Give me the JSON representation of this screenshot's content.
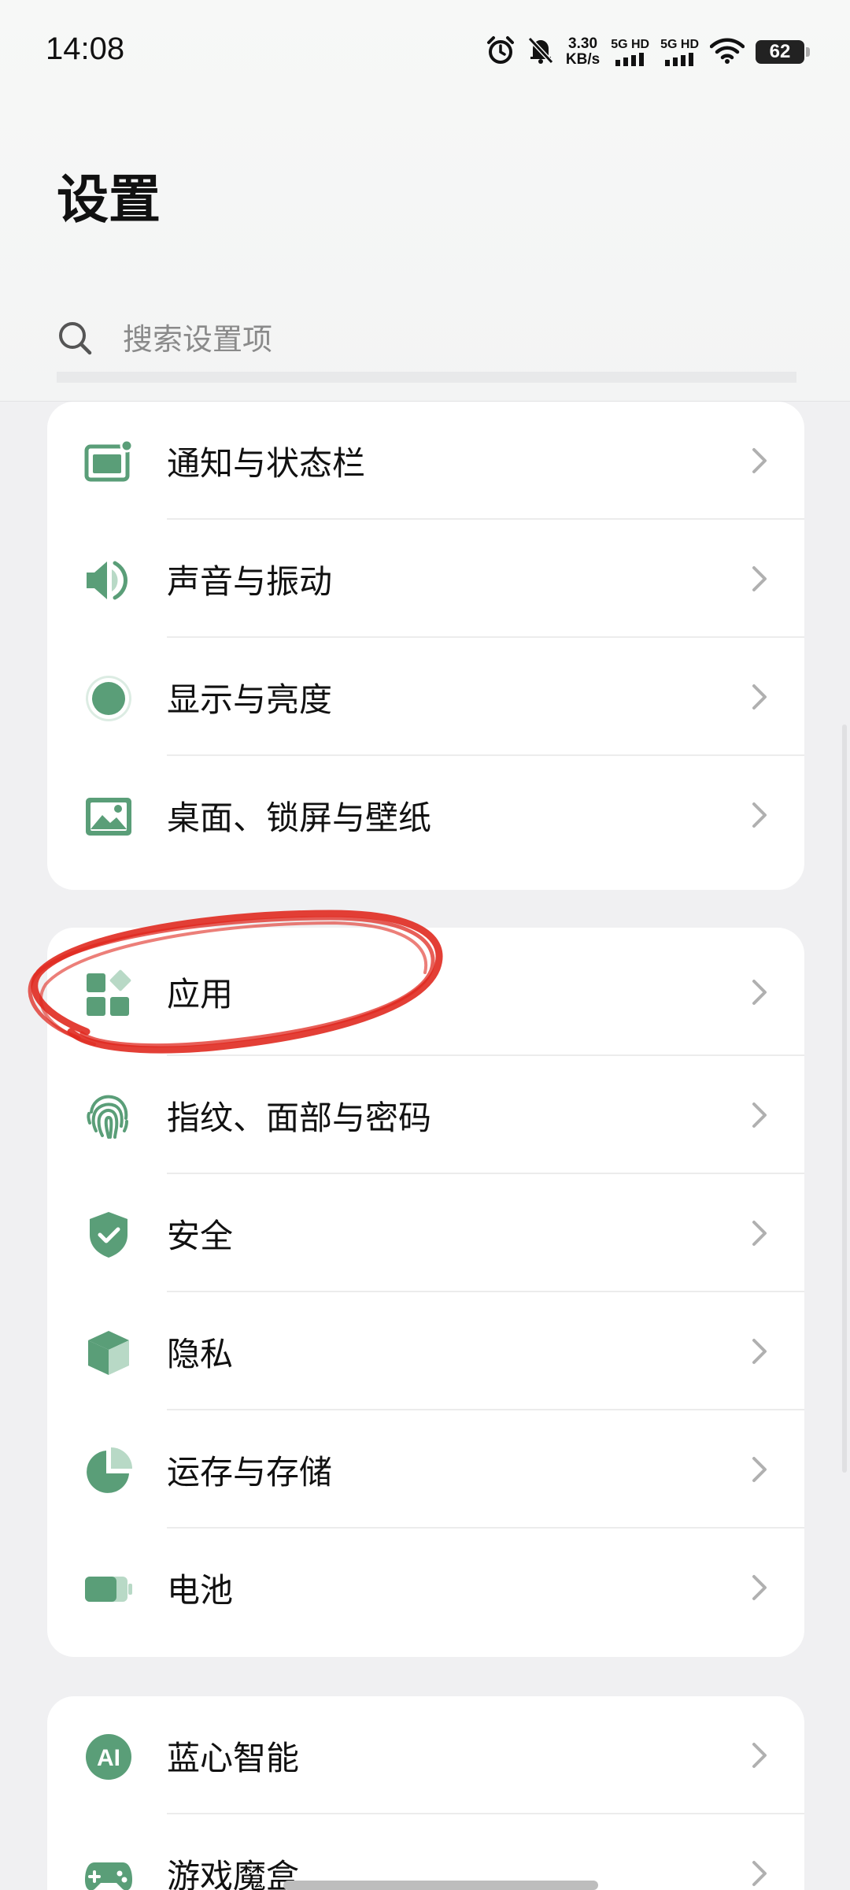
{
  "status_bar": {
    "time": "14:08",
    "net_speed_value": "3.30",
    "net_speed_unit": "KB/s",
    "sim1": "5G HD",
    "sim2": "5G HD",
    "battery": "62"
  },
  "page": {
    "title": "设置",
    "search_placeholder": "搜索设置项"
  },
  "groups": [
    {
      "items": [
        {
          "label": "通知与状态栏",
          "icon": "notification-icon"
        },
        {
          "label": "声音与振动",
          "icon": "speaker-icon"
        },
        {
          "label": "显示与亮度",
          "icon": "display-icon"
        },
        {
          "label": "桌面、锁屏与壁纸",
          "icon": "wallpaper-icon"
        }
      ]
    },
    {
      "items": [
        {
          "label": "应用",
          "icon": "apps-icon"
        },
        {
          "label": "指纹、面部与密码",
          "icon": "fingerprint-icon"
        },
        {
          "label": "安全",
          "icon": "shield-icon"
        },
        {
          "label": "隐私",
          "icon": "privacy-cube-icon"
        },
        {
          "label": "运存与存储",
          "icon": "storage-pie-icon"
        },
        {
          "label": "电池",
          "icon": "battery-icon"
        }
      ]
    },
    {
      "items": [
        {
          "label": "蓝心智能",
          "icon": "ai-icon"
        },
        {
          "label": "游戏魔盒",
          "icon": "gamepad-icon"
        }
      ]
    }
  ],
  "colors": {
    "accent": "#5a9e78",
    "accent_light": "#b8d9c6",
    "annotation_red": "#e02a20"
  }
}
